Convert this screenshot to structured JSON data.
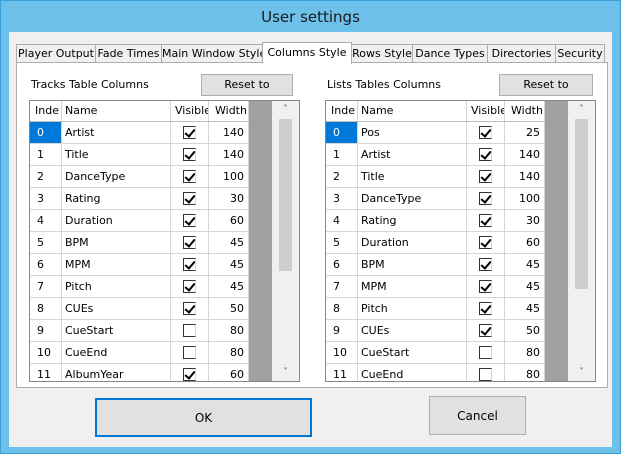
{
  "window": {
    "title": "User settings"
  },
  "tabs": [
    {
      "label": "Player Output"
    },
    {
      "label": "Fade Times"
    },
    {
      "label": "Main Window Style"
    },
    {
      "label": "Columns Style",
      "active": true
    },
    {
      "label": "Rows Style"
    },
    {
      "label": "Dance Types"
    },
    {
      "label": "Directories"
    },
    {
      "label": "Security"
    }
  ],
  "tracks": {
    "label": "Tracks Table Columns",
    "reset_label": "Reset to defaults",
    "headers": {
      "index": "Inde",
      "name": "Name",
      "visible": "Visible",
      "width": "Width"
    },
    "rows": [
      {
        "index": "0",
        "name": "Artist",
        "visible": true,
        "width": "140"
      },
      {
        "index": "1",
        "name": "Title",
        "visible": true,
        "width": "140"
      },
      {
        "index": "2",
        "name": "DanceType",
        "visible": true,
        "width": "100"
      },
      {
        "index": "3",
        "name": "Rating",
        "visible": true,
        "width": "30"
      },
      {
        "index": "4",
        "name": "Duration",
        "visible": true,
        "width": "60"
      },
      {
        "index": "5",
        "name": "BPM",
        "visible": true,
        "width": "45"
      },
      {
        "index": "6",
        "name": "MPM",
        "visible": true,
        "width": "45"
      },
      {
        "index": "7",
        "name": "Pitch",
        "visible": true,
        "width": "45"
      },
      {
        "index": "8",
        "name": "CUEs",
        "visible": true,
        "width": "50"
      },
      {
        "index": "9",
        "name": "CueStart",
        "visible": false,
        "width": "80"
      },
      {
        "index": "10",
        "name": "CueEnd",
        "visible": false,
        "width": "80"
      },
      {
        "index": "11",
        "name": "AlbumYear",
        "visible": true,
        "width": "60"
      }
    ]
  },
  "lists": {
    "label": "Lists Tables Columns",
    "reset_label": "Reset to defaults",
    "headers": {
      "index": "Inde",
      "name": "Name",
      "visible": "Visible",
      "width": "Width"
    },
    "rows": [
      {
        "index": "0",
        "name": "Pos",
        "visible": true,
        "width": "25"
      },
      {
        "index": "1",
        "name": "Artist",
        "visible": true,
        "width": "140"
      },
      {
        "index": "2",
        "name": "Title",
        "visible": true,
        "width": "140"
      },
      {
        "index": "3",
        "name": "DanceType",
        "visible": true,
        "width": "100"
      },
      {
        "index": "4",
        "name": "Rating",
        "visible": true,
        "width": "30"
      },
      {
        "index": "5",
        "name": "Duration",
        "visible": true,
        "width": "60"
      },
      {
        "index": "6",
        "name": "BPM",
        "visible": true,
        "width": "45"
      },
      {
        "index": "7",
        "name": "MPM",
        "visible": true,
        "width": "45"
      },
      {
        "index": "8",
        "name": "Pitch",
        "visible": true,
        "width": "45"
      },
      {
        "index": "9",
        "name": "CUEs",
        "visible": true,
        "width": "50"
      },
      {
        "index": "10",
        "name": "CueStart",
        "visible": false,
        "width": "80"
      },
      {
        "index": "11",
        "name": "CueEnd",
        "visible": false,
        "width": "80"
      }
    ]
  },
  "buttons": {
    "ok": "OK",
    "cancel": "Cancel"
  },
  "icons": {
    "scroll_up": "chevron-up-icon",
    "scroll_down": "chevron-down-icon",
    "checkbox": "checkmark-icon"
  },
  "colors": {
    "title_bar": "#6dc0ea",
    "selection": "#0078d7",
    "dialog_bg": "#f0f0f0"
  }
}
